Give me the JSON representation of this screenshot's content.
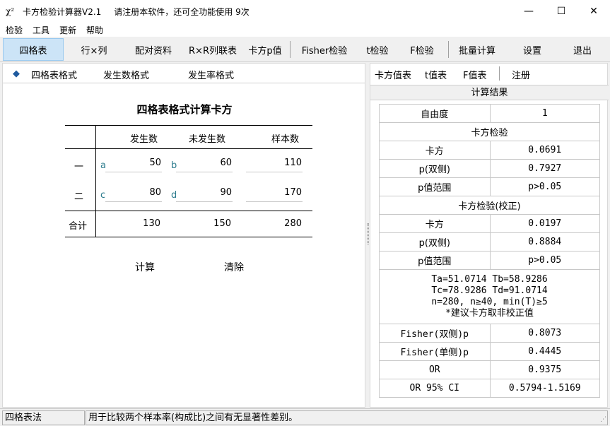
{
  "titlebar": {
    "icon": "χ²",
    "title": "卡方检验计算器V2.1",
    "message": "请注册本软件，还可全功能使用 9次",
    "minimize": "—",
    "maximize": "☐",
    "close": "✕"
  },
  "menu": [
    "检验",
    "工具",
    "更新",
    "帮助"
  ],
  "toolbar": [
    "四格表",
    "行×列",
    "配对资料",
    "R×R列联表",
    "卡方p值",
    "Fisher检验",
    "t检验",
    "F检验",
    "批量计算",
    "设置",
    "退出"
  ],
  "left": {
    "subtabs": [
      "四格表格式",
      "发生数格式",
      "发生率格式"
    ],
    "table_title": "四格表格式计算卡方",
    "headers": [
      "发生数",
      "未发生数",
      "样本数"
    ],
    "rows": [
      {
        "label": "一",
        "var1": "a",
        "occur": "50",
        "var2": "b",
        "nonoccur": "60",
        "total": "110"
      },
      {
        "label": "二",
        "var1": "c",
        "occur": "80",
        "var2": "d",
        "nonoccur": "90",
        "total": "170"
      }
    ],
    "total_row": {
      "label": "合计",
      "occur": "130",
      "nonoccur": "150",
      "total": "280"
    },
    "calc_button": "计算",
    "clear_button": "清除"
  },
  "right": {
    "tabs": [
      "卡方值表",
      "t值表",
      "F值表",
      "注册"
    ],
    "result_title": "计算结果",
    "df": {
      "k": "自由度",
      "v": "1"
    },
    "section1": "卡方检验",
    "chi": {
      "k": "卡方",
      "v": "0.0691"
    },
    "p2": {
      "k": "p(双侧)",
      "v": "0.7927"
    },
    "prange": {
      "k": "p值范围",
      "v": "p>0.05"
    },
    "section2": "卡方检验(校正)",
    "chi_c": {
      "k": "卡方",
      "v": "0.0197"
    },
    "p2_c": {
      "k": "p(双侧)",
      "v": "0.8884"
    },
    "prange_c": {
      "k": "p值范围",
      "v": "p>0.05"
    },
    "note": {
      "line1": "Ta=51.0714  Tb=58.9286",
      "line2": "Tc=78.9286  Td=91.0714",
      "line3": "n=280, n≥40, min(T)≥5",
      "line4": "*建议卡方取非校正值"
    },
    "fisher2": {
      "k": "Fisher(双侧)p",
      "v": "0.8073"
    },
    "fisher1": {
      "k": "Fisher(单侧)p",
      "v": "0.4445"
    },
    "or": {
      "k": "OR",
      "v": "0.9375"
    },
    "orci": {
      "k": "OR 95% CI",
      "v": "0.5794-1.5169"
    }
  },
  "status": {
    "left": "四格表法",
    "right": "用于比较两个样本率(构成比)之间有无显著性差别。"
  }
}
